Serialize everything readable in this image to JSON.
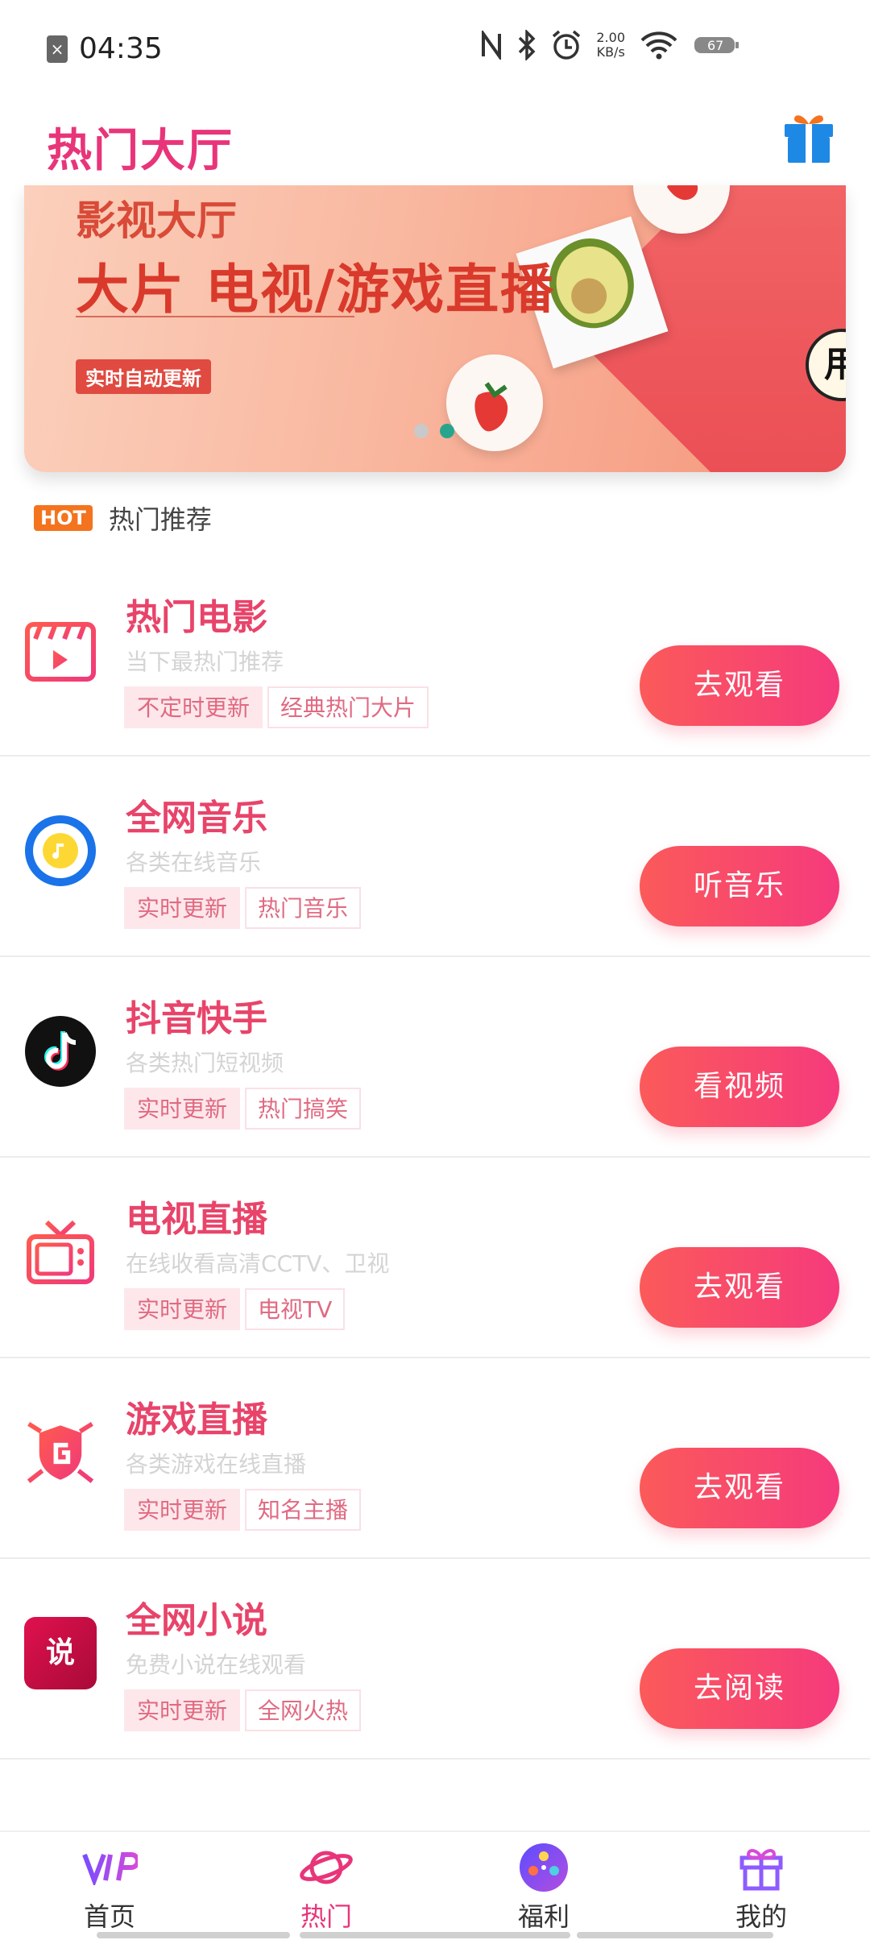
{
  "status_bar": {
    "time": "04:35",
    "speed_value": "2.00",
    "speed_unit": "KB/s",
    "battery": "67"
  },
  "header": {
    "title": "热门大厅"
  },
  "banner": {
    "subtitle": "影视大厅",
    "headline": "大片 电视/游戏直播",
    "badge": "实时自动更新",
    "corner_text": "用"
  },
  "section": {
    "hot_badge": "HOT",
    "title": "热门推荐"
  },
  "items": [
    {
      "title": "热门电影",
      "desc": "当下最热门推荐",
      "tags": [
        "不定时更新",
        "经典热门大片"
      ],
      "button": "去观看",
      "icon": "movie-clapper-icon"
    },
    {
      "title": "全网音乐",
      "desc": "各类在线音乐",
      "tags": [
        "实时更新",
        "热门音乐"
      ],
      "button": "听音乐",
      "icon": "music-disc-icon"
    },
    {
      "title": "抖音快手",
      "desc": "各类热门短视频",
      "tags": [
        "实时更新",
        "热门搞笑"
      ],
      "button": "看视频",
      "icon": "tiktok-icon"
    },
    {
      "title": "电视直播",
      "desc": "在线收看高清CCTV、卫视",
      "tags": [
        "实时更新",
        "电视TV"
      ],
      "button": "去观看",
      "icon": "tv-icon"
    },
    {
      "title": "游戏直播",
      "desc": "各类游戏在线直播",
      "tags": [
        "实时更新",
        "知名主播"
      ],
      "button": "去观看",
      "icon": "game-shield-icon"
    },
    {
      "title": "全网小说",
      "desc": "免费小说在线观看",
      "tags": [
        "实时更新",
        "全网火热"
      ],
      "button": "去阅读",
      "icon": "novel-icon",
      "icon_text": "说"
    }
  ],
  "bottom_nav": [
    {
      "label": "首页",
      "icon": "vip-icon",
      "active": false
    },
    {
      "label": "热门",
      "icon": "planet-icon",
      "active": true
    },
    {
      "label": "福利",
      "icon": "film-reel-icon",
      "active": false
    },
    {
      "label": "我的",
      "icon": "gift-icon",
      "active": false
    }
  ],
  "colors": {
    "accent": "#e8357a",
    "button_start": "#fb5a5a",
    "button_end": "#f53a7c",
    "hot_badge": "#f4731e"
  }
}
